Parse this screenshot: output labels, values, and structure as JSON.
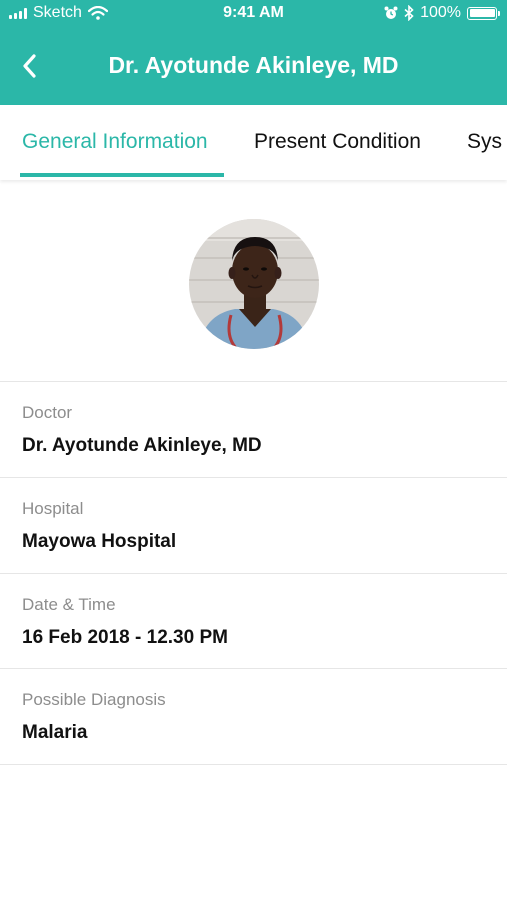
{
  "status_bar": {
    "carrier": "Sketch",
    "time": "9:41 AM",
    "battery": "100%"
  },
  "header": {
    "title": "Dr. Ayotunde Akinleye, MD",
    "back_icon": "chevron-left-icon",
    "background_color": "#2bb7a8"
  },
  "tabs": [
    {
      "label": "General Information",
      "active": true
    },
    {
      "label": "Present Condition",
      "active": false
    },
    {
      "label": "Sys",
      "active": false
    }
  ],
  "profile": {
    "avatar_icon": "doctor-avatar"
  },
  "fields": [
    {
      "label": "Doctor",
      "value": "Dr. Ayotunde Akinleye, MD"
    },
    {
      "label": "Hospital",
      "value": "Mayowa Hospital"
    },
    {
      "label": "Date & Time",
      "value": "16 Feb 2018 - 12.30 PM"
    },
    {
      "label": "Possible Diagnosis",
      "value": "Malaria"
    }
  ]
}
